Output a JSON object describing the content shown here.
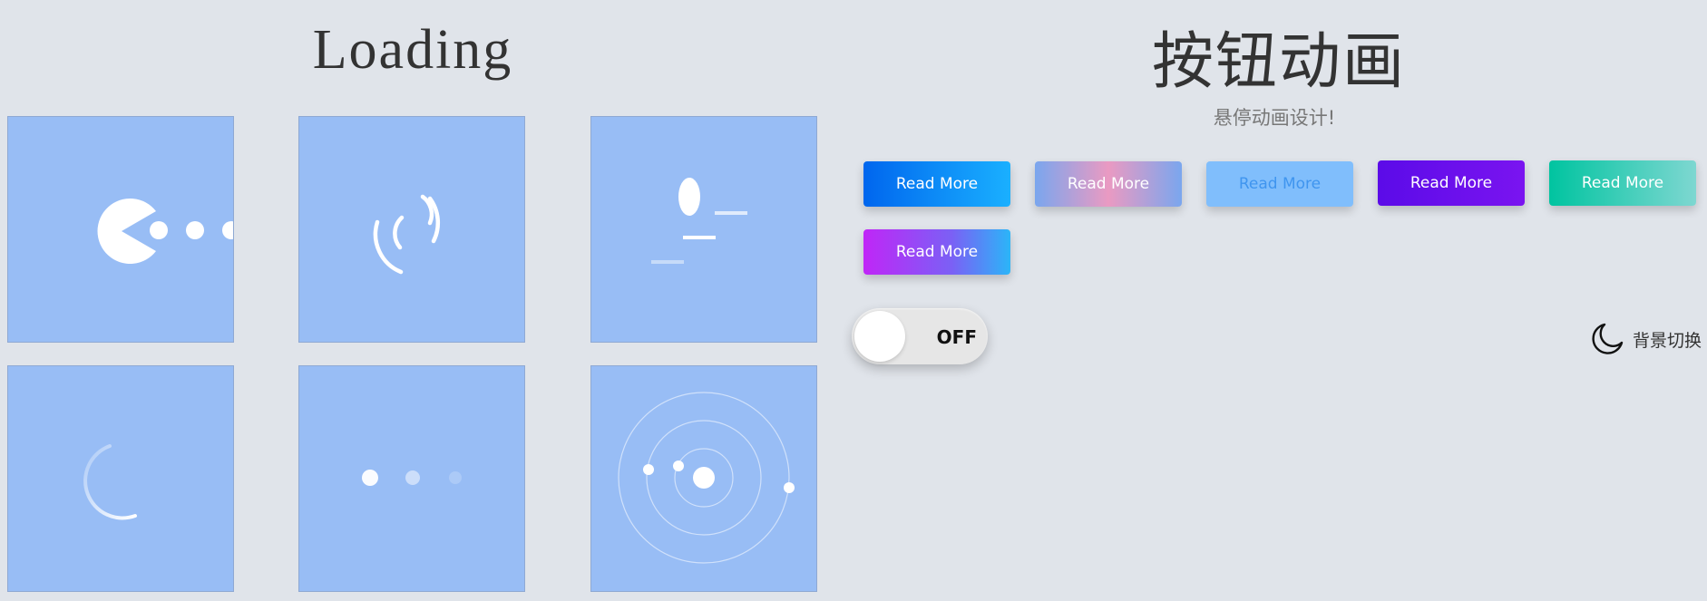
{
  "loading_section": {
    "title": "Loading",
    "tiles": [
      {
        "icon": "pacman-loader-icon"
      },
      {
        "icon": "signal-arcs-loader-icon"
      },
      {
        "icon": "bouncing-ball-loader-icon"
      },
      {
        "icon": "spinning-arc-loader-icon"
      },
      {
        "icon": "three-dots-loader-icon"
      },
      {
        "icon": "orbit-loader-icon"
      }
    ],
    "tile_color": "#98bdf5"
  },
  "buttons_section": {
    "title": "按钮动画",
    "subtitle": "悬停动画设计!",
    "buttons": [
      {
        "label": "Read More",
        "style": "blue-gradient"
      },
      {
        "label": "Read More",
        "style": "blue-pink-gradient"
      },
      {
        "label": "Read More",
        "style": "light-blue"
      },
      {
        "label": "Read More",
        "style": "purple"
      },
      {
        "label": "Read More",
        "style": "teal-gradient"
      },
      {
        "label": "Read More",
        "style": "magenta-cyan-gradient"
      }
    ],
    "toggle": {
      "label": "OFF",
      "state": "off"
    },
    "background_switch": {
      "label": "背景切换",
      "icon": "moon-icon"
    }
  }
}
